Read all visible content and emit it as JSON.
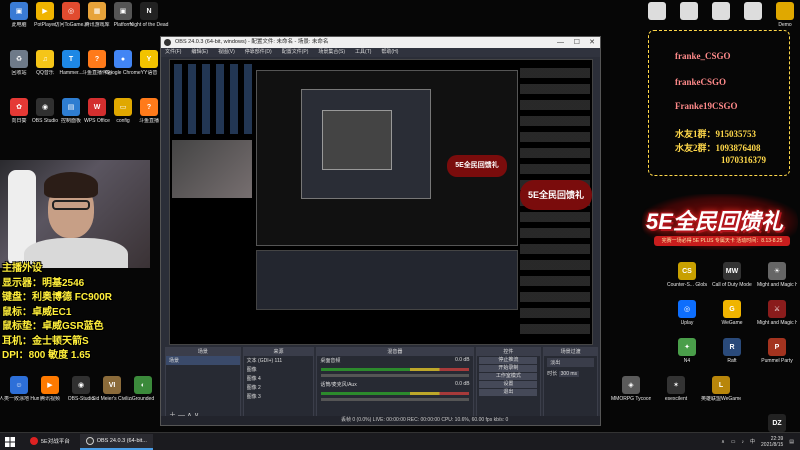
{
  "desktop": {
    "left_icons": [
      {
        "label": "此电脑",
        "color": "#3a7bd5",
        "glyph": "▣"
      },
      {
        "label": "PotPlayer",
        "color": "#f0b400",
        "glyph": "▶"
      },
      {
        "label": "访问ToGame...",
        "color": "#e14b2f",
        "glyph": "◎"
      },
      {
        "label": "腾讯游戏库",
        "color": "#e7a33a",
        "glyph": "▦"
      },
      {
        "label": "Platform",
        "color": "#555",
        "glyph": "▣"
      },
      {
        "label": "Night of the Dead",
        "color": "#222",
        "glyph": "N"
      },
      {
        "label": "回收站",
        "color": "#6e7a89",
        "glyph": "♻"
      },
      {
        "label": "QQ音乐",
        "color": "#f5c518",
        "glyph": "♫"
      },
      {
        "label": "Hammer...",
        "color": "#1e88e5",
        "glyph": "T"
      },
      {
        "label": "斗鱼直播伴侣",
        "color": "#ff7a1a",
        "glyph": "?"
      },
      {
        "label": "Google Chrome",
        "color": "#4285f4",
        "glyph": "●"
      },
      {
        "label": "YY语音",
        "color": "#f2c300",
        "glyph": "Y"
      },
      {
        "label": "向日葵",
        "color": "#e53935",
        "glyph": "✿"
      },
      {
        "label": "OBS Studio",
        "color": "#303030",
        "glyph": "◉"
      },
      {
        "label": "控制面板",
        "color": "#2e7dd1",
        "glyph": "▤"
      },
      {
        "label": "WPS Office",
        "color": "#d32f2f",
        "glyph": "W"
      },
      {
        "label": "config",
        "color": "#e0a800",
        "glyph": "▭"
      },
      {
        "label": "斗鱼直播",
        "color": "#ff7a1a",
        "glyph": "?"
      }
    ],
    "bottom_left_icons": [
      {
        "label": "人类一败涂地 Human Fa...",
        "color": "#2d6fd8",
        "glyph": "☺"
      },
      {
        "label": "腾讯视频",
        "color": "#ff7a00",
        "glyph": "▶"
      },
      {
        "label": "OBS-Studio",
        "color": "#303030",
        "glyph": "◉"
      },
      {
        "label": "Sid Meier's Civilizatio...",
        "color": "#8b6b3a",
        "glyph": "VI"
      },
      {
        "label": "Grounded",
        "color": "#3b8a3b",
        "glyph": "◐"
      }
    ],
    "right_top_icons": [
      {
        "label": "",
        "color": "#ddd"
      },
      {
        "label": "",
        "color": "#ddd"
      },
      {
        "label": "",
        "color": "#ddd"
      },
      {
        "label": "",
        "color": "#ddd"
      },
      {
        "label": "Demo",
        "color": "#e0a800"
      }
    ],
    "right_grid_icons": [
      {
        "label": "Counter-S... Global Off...",
        "color": "#c8a000",
        "glyph": "CS"
      },
      {
        "label": "Call of Duty Modern ...",
        "color": "#333",
        "glyph": "MW"
      },
      {
        "label": "Might and Magic He...",
        "color": "#666",
        "glyph": "☀"
      },
      {
        "label": "Uplay",
        "color": "#0d6efd",
        "glyph": "◎"
      },
      {
        "label": "WeGame",
        "color": "#f0b400",
        "glyph": "G"
      },
      {
        "label": "Might and Magic He...",
        "color": "#8a1c1c",
        "glyph": "⚔"
      },
      {
        "label": "N4",
        "color": "#4a9e4a",
        "glyph": "✦"
      },
      {
        "label": "Raft",
        "color": "#2a4a7a",
        "glyph": "R"
      },
      {
        "label": "Pummel Party",
        "color": "#a3331f",
        "glyph": "P"
      },
      {
        "label": "MMORPG Tycoon 2",
        "color": "#5a5a5a",
        "glyph": "◈"
      },
      {
        "label": "esexcilent",
        "color": "#333",
        "glyph": "✶"
      },
      {
        "label": "英雄联盟WeGame版",
        "color": "#b8860b",
        "glyph": "L"
      },
      {
        "label": "DayZ",
        "color": "#222",
        "glyph": "DZ"
      }
    ]
  },
  "stream_overlay": {
    "left_lines": [
      "主播外设",
      "显示器：明基2546",
      "键盘：利奥博德 FC900R",
      "鼠标：卓威EC1",
      "鼠标垫：卓威GSR蓝色",
      "耳机：金士顿天箭S",
      "DPI：800 敏度 1.65"
    ],
    "qq_card": {
      "names": [
        "franke_CSGO",
        "frankeCSGO",
        "Franke19CSGO"
      ],
      "group_lines": [
        {
          "label": "水友1群：",
          "number": "915035753"
        },
        {
          "label": "水友2群：",
          "number": "1093876408"
        },
        {
          "label": "",
          "number": "1070316379"
        }
      ]
    },
    "promo_banner": {
      "title": "5E全民回馈礼",
      "subtitle": "完赛一场必得 5E PLUS 专属天卡  活动时间：8.13-8.25"
    }
  },
  "obs_window": {
    "title": "OBS 24.0.3 (64-bit, windows) - 配置文件: 未命名 - 场景: 未命名",
    "menu": [
      "文件(F)",
      "编辑(E)",
      "视图(V)",
      "停靠部件(D)",
      "配置文件(P)",
      "场景集合(S)",
      "工具(T)",
      "帮助(H)"
    ],
    "docks": {
      "scenes": {
        "header": "场景",
        "items": [
          "场景"
        ]
      },
      "sources": {
        "header": "来源",
        "items": [
          "文本 (GDI+) 111",
          "图像",
          "图像 4",
          "图像 2",
          "图像 3"
        ]
      },
      "mixer": {
        "header": "混音器",
        "channels": [
          {
            "name": "桌面音频",
            "db": "0.0 dB"
          },
          {
            "name": "话筒/麦克风/Aux",
            "db": "0.0 dB"
          }
        ]
      },
      "controls": {
        "header": "控件",
        "buttons": [
          "停止推流",
          "开始录制",
          "工作室模式",
          "设置",
          "退出"
        ]
      },
      "transitions": {
        "header": "场景过渡",
        "type": "淡出",
        "duration_label": "时长",
        "duration": "300 ms"
      }
    },
    "statusbar": "丢帧 0 (0.0%)     LIVE: 00:00:00     REC: 00:00:00     CPU: 10.6%, 60.00 fps     kb/s: 0"
  },
  "taskbar": {
    "tasks": [
      {
        "label": "5E对战平台",
        "active": false
      },
      {
        "label": "OBS 24.0.3 (64-bit...",
        "active": true
      }
    ],
    "clock": {
      "time": "22:39",
      "date": "2021/8/15"
    }
  }
}
